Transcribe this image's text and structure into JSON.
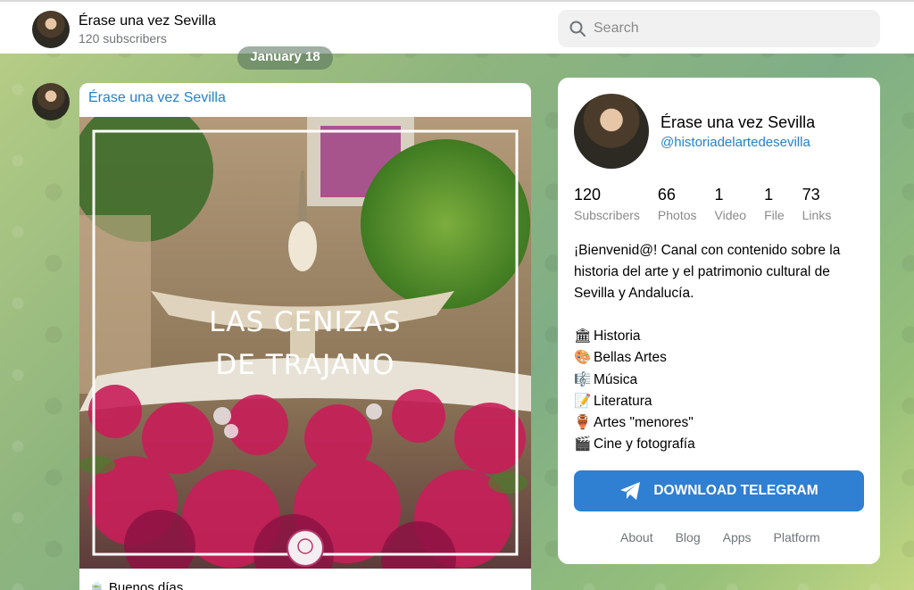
{
  "header": {
    "channel_name": "Érase una vez Sevilla",
    "subscribers": "120 subscribers",
    "search_placeholder": "Search"
  },
  "feed": {
    "date": "January 18",
    "message": {
      "author": "Érase una vez Sevilla",
      "image_title_line1": "LAS CENIZAS",
      "image_title_line2": "DE TRAJANO",
      "caption": "🍵 Buenos días"
    }
  },
  "profile": {
    "name": "Érase una vez Sevilla",
    "handle": "@historiadelartedesevilla",
    "stats": [
      {
        "value": "120",
        "label": "Subscribers"
      },
      {
        "value": "66",
        "label": "Photos"
      },
      {
        "value": "1",
        "label": "Video"
      },
      {
        "value": "1",
        "label": "File"
      },
      {
        "value": "73",
        "label": "Links"
      }
    ],
    "description": "¡Bienvenid@! Canal con contenido sobre la historia del arte y el patrimonio cultural de Sevilla y Andalucía.",
    "features": [
      {
        "emoji": "🏛",
        "label": "Historia"
      },
      {
        "emoji": "🎨",
        "label": "Bellas Artes"
      },
      {
        "emoji": "🎼",
        "label": "Música"
      },
      {
        "emoji": "📝",
        "label": "Literatura"
      },
      {
        "emoji": "🏺",
        "label": "Artes \"menores\""
      },
      {
        "emoji": "🎬",
        "label": " Cine y fotografía"
      }
    ],
    "download_label": "DOWNLOAD TELEGRAM",
    "footer_links": [
      "About",
      "Blog",
      "Apps",
      "Platform"
    ]
  },
  "colors": {
    "accent": "#2481cc",
    "button": "#2f7fd3"
  }
}
